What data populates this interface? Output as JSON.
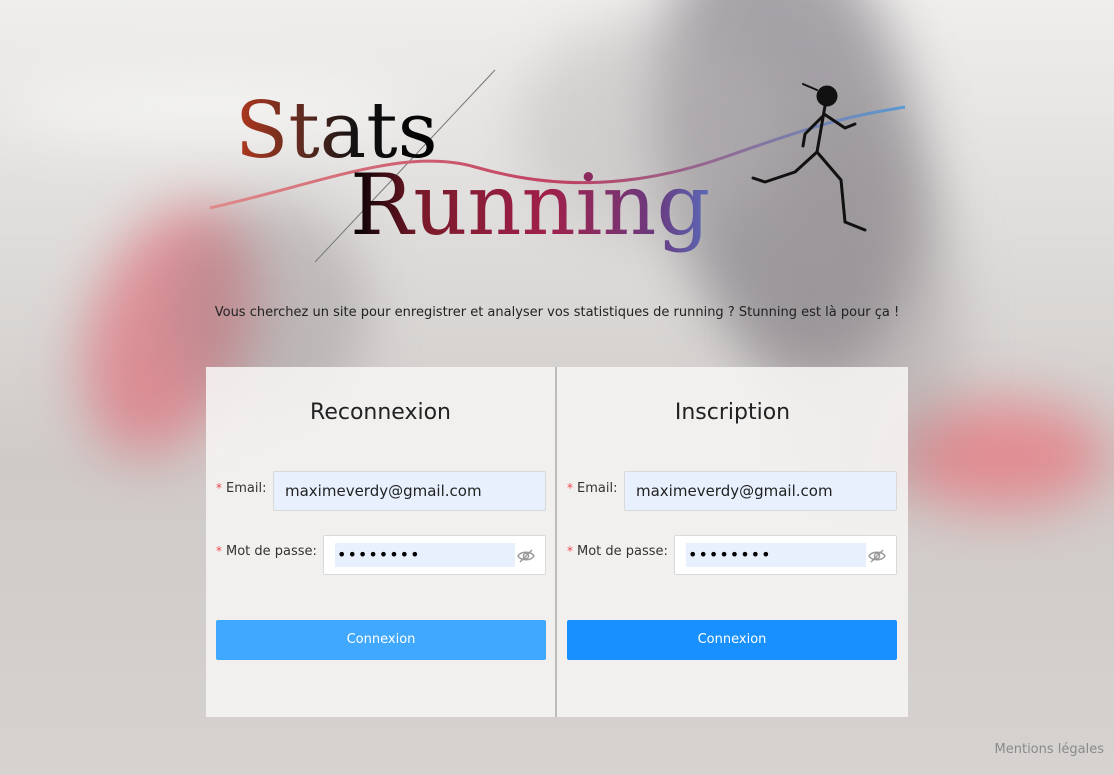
{
  "logo": {
    "word1": "Stats",
    "word2": "Running"
  },
  "tagline": "Vous cherchez un site pour enregistrer et analyser vos statistiques de running ? Stunning est là pour ça !",
  "login": {
    "title": "Reconnexion",
    "email_label": "Email",
    "email_value": "maximeverdy@gmail.com",
    "password_label": "Mot de passe",
    "password_value": "••••••••",
    "button_label": "Connexion"
  },
  "signup": {
    "title": "Inscription",
    "email_label": "Email",
    "email_value": "maximeverdy@gmail.com",
    "password_label": "Mot de passe",
    "password_value": "••••••••",
    "button_label": "Connexion"
  },
  "required_marker": "*",
  "label_suffix": ":",
  "footer": {
    "legal_link": "Mentions légales"
  },
  "colors": {
    "primary": "#1890ff",
    "primary_light": "#40a9ff",
    "required": "#f04848",
    "autofill": "#e8f0fe"
  }
}
